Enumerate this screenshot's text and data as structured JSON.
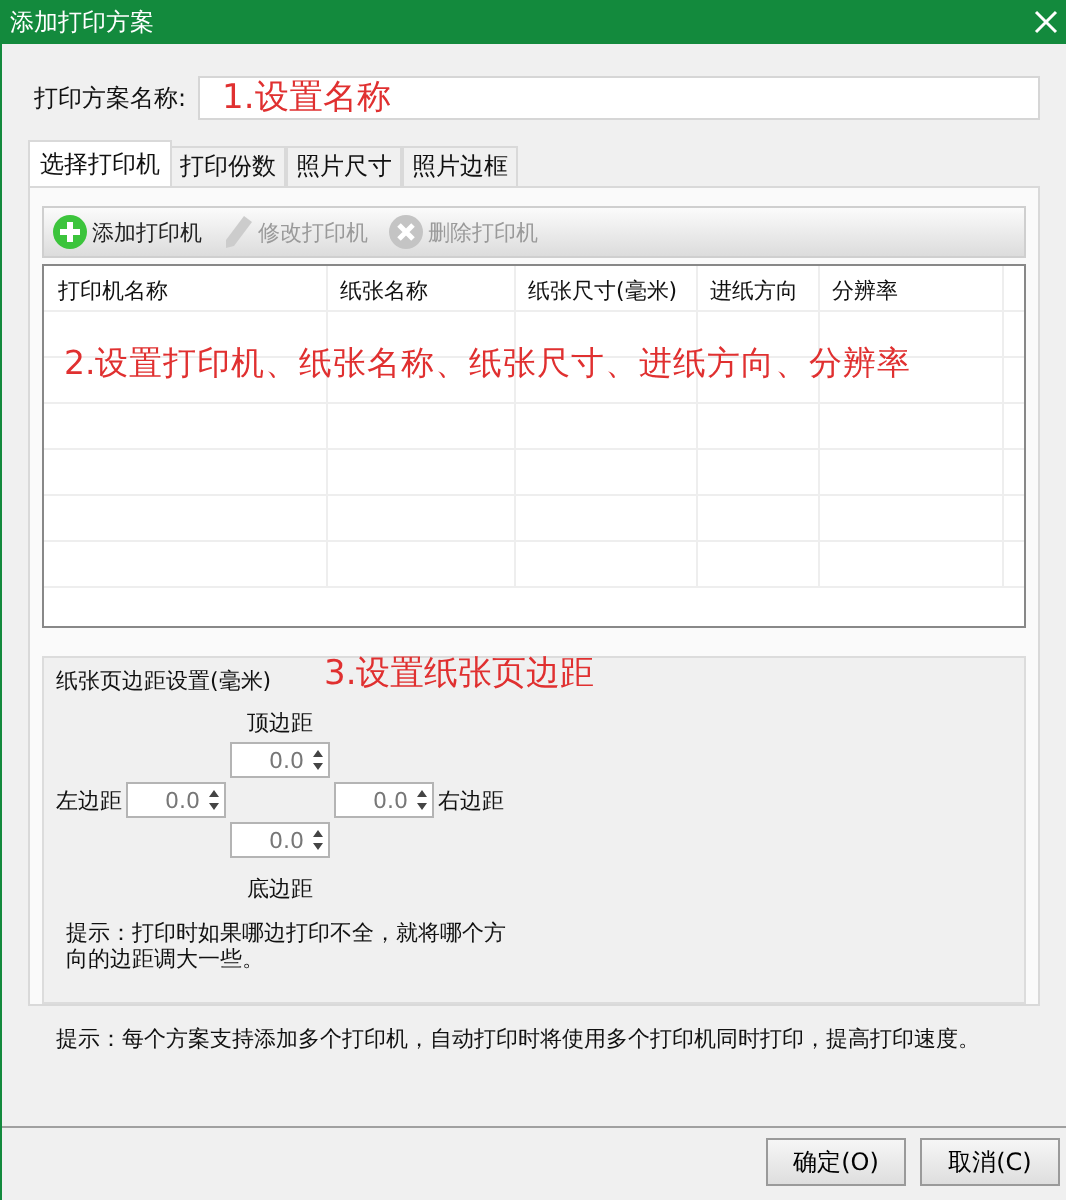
{
  "window": {
    "title": "添加打印方案"
  },
  "name_field": {
    "label": "打印方案名称:",
    "annotation": "1.设置名称"
  },
  "tabs": [
    {
      "label": "选择打印机",
      "selected": true
    },
    {
      "label": "打印份数",
      "selected": false
    },
    {
      "label": "照片尺寸",
      "selected": false
    },
    {
      "label": "照片边框",
      "selected": false
    }
  ],
  "toolbar": [
    {
      "kind": "add",
      "label": "添加打印机",
      "disabled": false
    },
    {
      "kind": "edit",
      "label": "修改打印机",
      "disabled": true
    },
    {
      "kind": "delete",
      "label": "删除打印机",
      "disabled": true
    }
  ],
  "table": {
    "columns": [
      "打印机名称",
      "纸张名称",
      "纸张尺寸(毫米)",
      "进纸方向",
      "分辨率"
    ],
    "annotation": "2.设置打印机、纸张名称、纸张尺寸、进纸方向、分辨率"
  },
  "margins": {
    "title": "纸张页边距设置(毫米)",
    "annotation": "3.设置纸张页边距",
    "top": {
      "label": "顶边距",
      "value": "0.0"
    },
    "left": {
      "label": "左边距",
      "value": "0.0"
    },
    "right": {
      "label": "右边距",
      "value": "0.0"
    },
    "bottom": {
      "label": "底边距",
      "value": "0.0"
    },
    "hint": "提示：打印时如果哪边打印不全，就将哪个方向的边距调大一些。"
  },
  "tip": "提示：每个方案支持添加多个打印机，自动打印时将使用多个打印机同时打印，提高打印速度。",
  "buttons": [
    {
      "label": "确定(O)"
    },
    {
      "label": "取消(C)"
    }
  ]
}
